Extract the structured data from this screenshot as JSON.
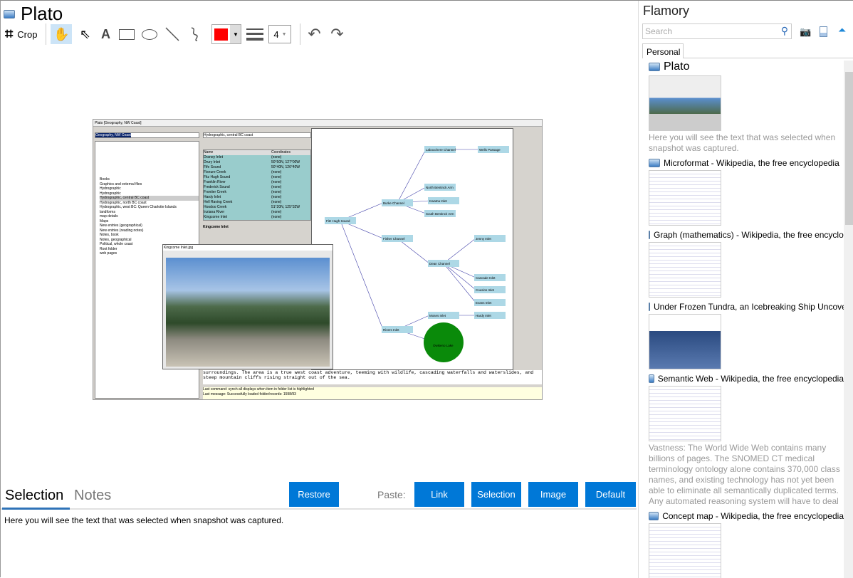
{
  "app": {
    "title": "Plato"
  },
  "toolbar": {
    "crop_label": "Crop",
    "line_width": "4",
    "color": "#ff0000"
  },
  "snapshot": {
    "window_title": "Plato [Geography, NW Coast]",
    "left_combo": "Geography, NW Coast",
    "right_combo": "Hydrographic, central BC coast",
    "folder_items": [
      "Books",
      "Graphics and external files",
      "Hydrographic",
      "Hydrographic",
      "Hydrographic, central BC coast",
      "Hydrographic, north BC coast",
      "Hydrographic, west BC: Queen Charlotte Islands",
      "landforms",
      "map details",
      "Maps",
      "New entries (geographical)",
      "New entries (reading notes)",
      "Notes, book",
      "Notes, geographical",
      "Political, whole coast",
      "Root folder",
      "web pages"
    ],
    "table_headers": [
      "Name",
      "Coordinates"
    ],
    "table_rows": [
      [
        "Draney Inlet",
        "(none)"
      ],
      [
        "Drury Inlet",
        "50°50N, 127°00W"
      ],
      [
        "Fife Sound",
        "50°40N, 126°40W"
      ],
      [
        "Fisnure Creek",
        "(none)"
      ],
      [
        "Fitz Hugh Sound",
        "(none)"
      ],
      [
        "Franklin River",
        "(none)"
      ],
      [
        "Frederick Sound",
        "(none)"
      ],
      [
        "Frontier Creek",
        "(none)"
      ],
      [
        "Hardy Inlet",
        "(none)"
      ],
      [
        "Hell Raving Creek",
        "(none)"
      ],
      [
        "Hoodoo Creek",
        "51°20N, 125°32W"
      ],
      [
        "Inziana River",
        "(none)"
      ],
      [
        "Kingcome Inlet",
        "(none)"
      ]
    ],
    "record_title": "Kingcome Inlet",
    "graph_nodes": [
      "Fitz Hugh Sound",
      "Burke Channel",
      "Fisher Channel",
      "Labouchere Channel",
      "Wells Passage",
      "North Bentinck Arm",
      "Kwatna Inlet",
      "South Bentinck Arm",
      "Dean Channel",
      "Rivers Inlet",
      "Moses Inlet",
      "Hardy Inlet",
      "Owikeno Lake",
      "Jenny Inlet",
      "Cascade Inlet",
      "Cousins Inlet",
      "Evans Inlet"
    ],
    "image_viewer_title": "Kingcome Inlet.jpg",
    "body_text": "surroundings. The area is a true west coast adventure, teeming with wildlife, cascading waterfalls and waterslides, and steep mountain cliffs rising straight out of the sea.",
    "status_last_command": "Last command:",
    "status_command": "synch all displays when item in folder list is highlighted",
    "status_last_message": "Last message:",
    "status_message": "Successfully loaded folder/records: 1598/93"
  },
  "bottom": {
    "tabs": [
      "Selection",
      "Notes"
    ],
    "restore": "Restore",
    "paste_label": "Paste:",
    "paste_buttons": [
      "Link",
      "Selection",
      "Image",
      "Default"
    ],
    "selection_text": "Here you will see the text that was selected when snapshot was captured."
  },
  "sidebar": {
    "title": "Flamory",
    "search_placeholder": "Search",
    "tab": "Personal",
    "items": [
      {
        "title": "Plato",
        "desc": "Here you will see the text that was selected when snapshot was captured."
      },
      {
        "title": "Microformat - Wikipedia, the free encyclopedia",
        "desc": ""
      },
      {
        "title": "Graph (mathematics) - Wikipedia, the free encyclopedia",
        "desc": ""
      },
      {
        "title": "Under Frozen Tundra, an Icebreaking Ship Uncovers...",
        "desc": ""
      },
      {
        "title": "Semantic Web - Wikipedia, the free encyclopedia",
        "desc": "Vastness: The World Wide Web contains many billions of pages. The SNOMED CT medical terminology ontology alone contains 370,000 class names, and existing technology has not yet been able to eliminate all semantically duplicated terms. Any automated reasoning system will have to deal with truly huge inputs."
      },
      {
        "title": "Concept map - Wikipedia, the free encyclopedia",
        "desc": ""
      }
    ]
  }
}
